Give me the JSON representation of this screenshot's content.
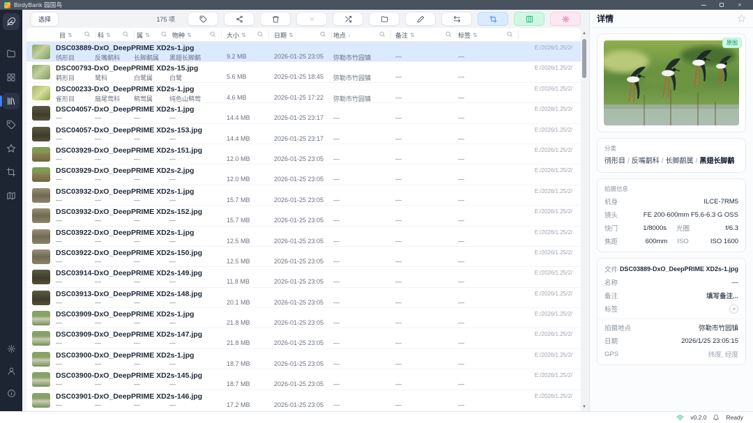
{
  "titlebar": {
    "title": "BirdyBank 园国鸟"
  },
  "sidebar": {
    "top": [
      {
        "icon": "feather",
        "style": "logo"
      },
      {
        "icon": "folder",
        "style": ""
      },
      {
        "icon": "grid",
        "style": ""
      },
      {
        "icon": "library",
        "style": "active"
      },
      {
        "icon": "tag",
        "style": ""
      },
      {
        "icon": "star",
        "style": ""
      },
      {
        "icon": "crop",
        "style": ""
      },
      {
        "icon": "map",
        "style": ""
      }
    ],
    "bottom": [
      {
        "icon": "gear",
        "style": "bottom"
      },
      {
        "icon": "user",
        "style": "bottom"
      },
      {
        "icon": "info",
        "style": "bottom"
      }
    ]
  },
  "toolbar": {
    "select_label": "选择",
    "item_count": "175 项",
    "buttons": [
      {
        "icon": "tag",
        "style": ""
      },
      {
        "icon": "share",
        "style": ""
      },
      {
        "icon": "trash",
        "style": ""
      },
      {
        "icon": "close",
        "style": "disabled"
      },
      {
        "icon": "transfer",
        "style": ""
      },
      {
        "icon": "folder",
        "style": ""
      },
      {
        "icon": "edit",
        "style": ""
      },
      {
        "icon": "swap",
        "style": ""
      },
      {
        "icon": "crop",
        "style": "blue"
      },
      {
        "icon": "columns",
        "style": "green"
      },
      {
        "icon": "settings",
        "style": "pink"
      }
    ]
  },
  "table": {
    "columns": [
      {
        "label": "目",
        "sort": "both",
        "search": true
      },
      {
        "label": "科",
        "sort": "both",
        "search": true
      },
      {
        "label": "属",
        "sort": "both",
        "search": true
      },
      {
        "label": "物种",
        "sort": "both",
        "search": true
      },
      {
        "label": "大小",
        "sort": "both",
        "search": true
      },
      {
        "label": "日期",
        "sort": "both",
        "search": true
      },
      {
        "label": "地点",
        "sort": "desc",
        "search": true
      },
      {
        "label": "备注",
        "sort": "both",
        "search": true
      },
      {
        "label": "标签",
        "sort": "both",
        "search": true
      }
    ],
    "rows": [
      {
        "file": "DSC03889-DxO_DeepPRIME XD2s-1.jpg",
        "order": "鸻形目",
        "family": "反嘴鹬科",
        "genus": "长脚鹬属",
        "species": "黑翅长脚鹬",
        "size": "9.2 MB",
        "date": "2026-01-25 23:05",
        "location": "弥勒市竹园镇",
        "note": "—",
        "tags": "—",
        "path": "E:/2026/1.25/2/",
        "selected": true,
        "thumb": "t1"
      },
      {
        "file": "DSC00793-DxO_DeepPRIME XD2s-15.jpg",
        "order": "鹈形目",
        "family": "鹭科",
        "genus": "白鹭属",
        "species": "白鹭",
        "size": "5.6 MB",
        "date": "2026-01-25 18:45",
        "location": "弥勒市竹园镇",
        "note": "—",
        "tags": "—",
        "path": "E:/2026/1.25/2/",
        "selected": false,
        "thumb": "t1"
      },
      {
        "file": "DSC00233-DxO_DeepPRIME XD2s-1.jpg",
        "order": "雀形目",
        "family": "扇尾莺科",
        "genus": "鹪莺属",
        "species": "纯色山鹪莺",
        "size": "4.6 MB",
        "date": "2026-01-25 17:22",
        "location": "弥勒市竹园镇",
        "note": "—",
        "tags": "—",
        "path": "E:/2026/1.25/2/",
        "selected": false,
        "thumb": "t2"
      },
      {
        "file": "DSC04057-DxO_DeepPRIME XD2s-1.jpg",
        "order": "—",
        "family": "—",
        "genus": "—",
        "species": "—",
        "size": "14.4 MB",
        "date": "2026-01-25 23:17",
        "location": "—",
        "note": "—",
        "tags": "—",
        "path": "E:/2026/1.25/2/",
        "selected": false,
        "thumb": "t3"
      },
      {
        "file": "DSC04057-DxO_DeepPRIME XD2s-153.jpg",
        "order": "—",
        "family": "—",
        "genus": "—",
        "species": "—",
        "size": "14.4 MB",
        "date": "2026-01-25 23:17",
        "location": "—",
        "note": "—",
        "tags": "—",
        "path": "E:/2026/1.25/2/",
        "selected": false,
        "thumb": "t3"
      },
      {
        "file": "DSC03929-DxO_DeepPRIME XD2s-151.jpg",
        "order": "—",
        "family": "—",
        "genus": "—",
        "species": "—",
        "size": "12.0 MB",
        "date": "2026-01-25 23:05",
        "location": "—",
        "note": "—",
        "tags": "—",
        "path": "E:/2026/1.25/2/",
        "selected": false,
        "thumb": "t4"
      },
      {
        "file": "DSC03929-DxO_DeepPRIME XD2s-2.jpg",
        "order": "—",
        "family": "—",
        "genus": "—",
        "species": "—",
        "size": "12.0 MB",
        "date": "2026-01-25 23:05",
        "location": "—",
        "note": "—",
        "tags": "—",
        "path": "E:/2026/1.25/2/",
        "selected": false,
        "thumb": "t4"
      },
      {
        "file": "DSC03932-DxO_DeepPRIME XD2s-1.jpg",
        "order": "—",
        "family": "—",
        "genus": "—",
        "species": "—",
        "size": "15.7 MB",
        "date": "2026-01-25 23:05",
        "location": "—",
        "note": "—",
        "tags": "—",
        "path": "E:/2026/1.25/2/",
        "selected": false,
        "thumb": "t5"
      },
      {
        "file": "DSC03932-DxO_DeepPRIME XD2s-152.jpg",
        "order": "—",
        "family": "—",
        "genus": "—",
        "species": "—",
        "size": "15.7 MB",
        "date": "2026-01-25 23:05",
        "location": "—",
        "note": "—",
        "tags": "—",
        "path": "E:/2026/1.25/2/",
        "selected": false,
        "thumb": "t5"
      },
      {
        "file": "DSC03922-DxO_DeepPRIME XD2s-1.jpg",
        "order": "—",
        "family": "—",
        "genus": "—",
        "species": "—",
        "size": "12.5 MB",
        "date": "2026-01-25 23:05",
        "location": "—",
        "note": "—",
        "tags": "—",
        "path": "E:/2026/1.25/2/",
        "selected": false,
        "thumb": "t5"
      },
      {
        "file": "DSC03922-DxO_DeepPRIME XD2s-150.jpg",
        "order": "—",
        "family": "—",
        "genus": "—",
        "species": "—",
        "size": "12.5 MB",
        "date": "2026-01-25 23:05",
        "location": "—",
        "note": "—",
        "tags": "—",
        "path": "E:/2026/1.25/2/",
        "selected": false,
        "thumb": "t5"
      },
      {
        "file": "DSC03914-DxO_DeepPRIME XD2s-149.jpg",
        "order": "—",
        "family": "—",
        "genus": "—",
        "species": "—",
        "size": "11.8 MB",
        "date": "2026-01-25 23:05",
        "location": "—",
        "note": "—",
        "tags": "—",
        "path": "E:/2026/1.25/2/",
        "selected": false,
        "thumb": "t3"
      },
      {
        "file": "DSC03913-DxO_DeepPRIME XD2s-148.jpg",
        "order": "—",
        "family": "—",
        "genus": "—",
        "species": "—",
        "size": "20.1 MB",
        "date": "2026-01-25 23:05",
        "location": "—",
        "note": "—",
        "tags": "—",
        "path": "E:/2026/1.25/2/",
        "selected": false,
        "thumb": "t3"
      },
      {
        "file": "DSC03909-DxO_DeepPRIME XD2s-1.jpg",
        "order": "—",
        "family": "—",
        "genus": "—",
        "species": "—",
        "size": "21.8 MB",
        "date": "2026-01-25 23:05",
        "location": "—",
        "note": "—",
        "tags": "—",
        "path": "E:/2026/1.25/2/",
        "selected": false,
        "thumb": "t6"
      },
      {
        "file": "DSC03909-DxO_DeepPRIME XD2s-147.jpg",
        "order": "—",
        "family": "—",
        "genus": "—",
        "species": "—",
        "size": "21.8 MB",
        "date": "2026-01-25 23:05",
        "location": "—",
        "note": "—",
        "tags": "—",
        "path": "E:/2026/1.25/2/",
        "selected": false,
        "thumb": "t6"
      },
      {
        "file": "DSC03900-DxO_DeepPRIME XD2s-1.jpg",
        "order": "—",
        "family": "—",
        "genus": "—",
        "species": "—",
        "size": "18.7 MB",
        "date": "2026-01-25 23:05",
        "location": "—",
        "note": "—",
        "tags": "—",
        "path": "E:/2026/1.25/2/",
        "selected": false,
        "thumb": "t6"
      },
      {
        "file": "DSC03900-DxO_DeepPRIME XD2s-145.jpg",
        "order": "—",
        "family": "—",
        "genus": "—",
        "species": "—",
        "size": "18.7 MB",
        "date": "2026-01-25 23:05",
        "location": "—",
        "note": "—",
        "tags": "—",
        "path": "E:/2026/1.25/2/",
        "selected": false,
        "thumb": "t6"
      },
      {
        "file": "DSC03901-DxO_DeepPRIME XD2s-146.jpg",
        "order": "—",
        "family": "—",
        "genus": "—",
        "species": "—",
        "size": "17.2 MB",
        "date": "2026-01-25 23:05",
        "location": "—",
        "note": "—",
        "tags": "—",
        "path": "E:/2026/1.25/2/",
        "selected": false,
        "thumb": "t6"
      }
    ]
  },
  "details": {
    "title": "详情",
    "original_badge": "原图",
    "category": {
      "label": "分类",
      "path": [
        "鸻形目",
        "反嘴鹬科",
        "长脚鹬属",
        "黑翅长脚鹬"
      ]
    },
    "shooting": {
      "label": "拍摄信息",
      "body_label": "机身",
      "body": "ILCE-7RM5",
      "lens_label": "镜头",
      "lens": "FE 200-600mm F5.6-6.3 G OSS",
      "shutter_label": "快门",
      "shutter": "1/8000s",
      "aperture_label": "光圈",
      "aperture": "f/6.3",
      "focal_label": "焦距",
      "focal": "600mm",
      "iso_label": "ISO",
      "iso": "ISO 1600"
    },
    "file": {
      "file_label": "文件",
      "file": "DSC03889-DxO_DeepPRIME XD2s-1.jpg",
      "name_label": "名称",
      "name": "—",
      "note_label": "备注",
      "note_placeholder": "填写备注...",
      "tag_label": "标签",
      "location_label": "拍摄地点",
      "location": "弥勒市竹园镇",
      "date_label": "日期",
      "date": "2026/1/25 23:05:15",
      "gps_label": "GPS",
      "gps": "纬度, 经度"
    }
  },
  "statusbar": {
    "version": "v0.2.0",
    "status": "Ready"
  }
}
